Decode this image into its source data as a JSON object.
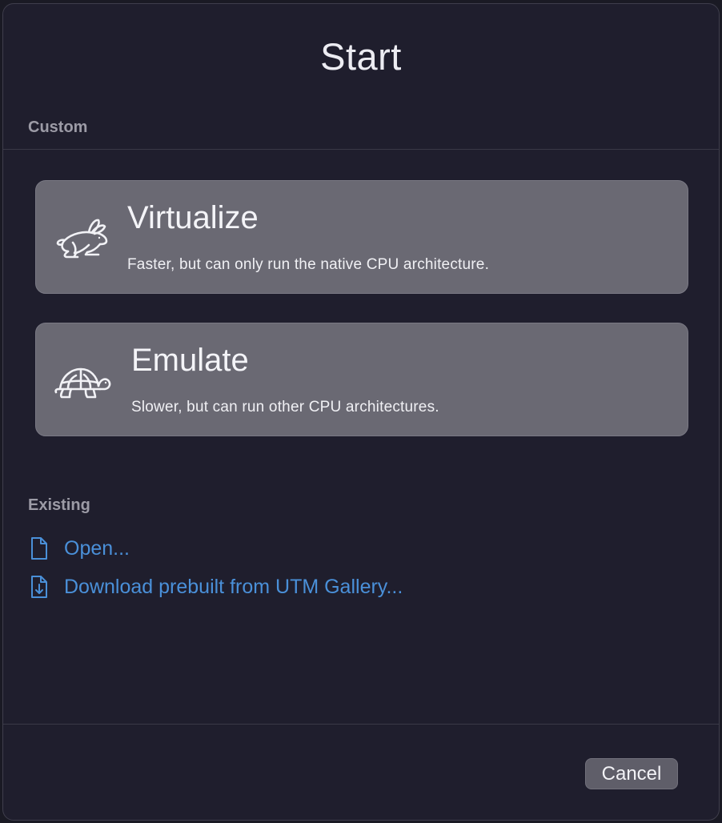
{
  "window": {
    "title": "Start"
  },
  "custom_section": {
    "label": "Custom",
    "options": [
      {
        "icon": "hare-icon",
        "title": "Virtualize",
        "description": "Faster, but can only run the native CPU architecture."
      },
      {
        "icon": "tortoise-icon",
        "title": "Emulate",
        "description": "Slower, but can run other CPU architectures."
      }
    ]
  },
  "existing_section": {
    "label": "Existing",
    "links": [
      {
        "icon": "document-icon",
        "label": "Open..."
      },
      {
        "icon": "document-download-icon",
        "label": "Download prebuilt from UTM Gallery..."
      }
    ]
  },
  "footer": {
    "cancel_label": "Cancel"
  },
  "colors": {
    "background": "#1f1e2d",
    "card": "#6a6973",
    "link": "#4a90d9",
    "button": "#5f5e69"
  }
}
